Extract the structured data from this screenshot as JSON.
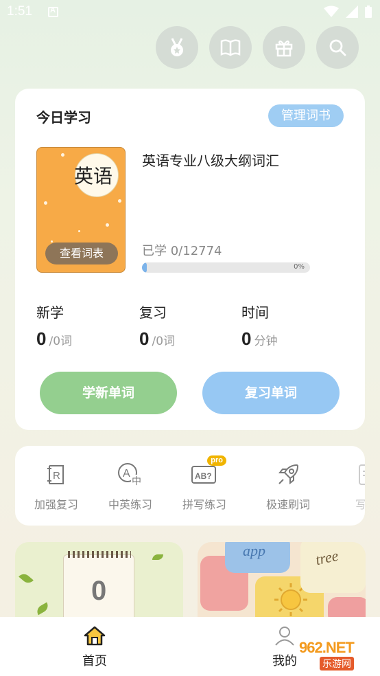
{
  "status": {
    "time": "1:51"
  },
  "top_icons": [
    "medal-icon",
    "book-icon",
    "gift-icon",
    "search-icon"
  ],
  "today": {
    "title": "今日学习",
    "manage_label": "管理词书",
    "book": {
      "cover_word": "英语",
      "view_list_label": "查看词表",
      "name": "英语专业八级大纲词汇",
      "learned_text": "已学 0/12774",
      "progress_percent": 0,
      "progress_label": "0%"
    },
    "stats": [
      {
        "label": "新学",
        "value": "0",
        "unit": "/0词"
      },
      {
        "label": "复习",
        "value": "0",
        "unit": "/0词"
      },
      {
        "label": "时间",
        "value": "0",
        "unit": "分钟"
      }
    ],
    "learn_new_label": "学新单词",
    "review_label": "复习单词"
  },
  "tools": [
    {
      "label": "加强复习",
      "icon": "review-card-icon"
    },
    {
      "label": "中英练习",
      "icon": "translate-icon"
    },
    {
      "label": "拼写练习",
      "icon": "spelling-icon",
      "badge": "pro"
    },
    {
      "label": "极速刷词",
      "icon": "rocket-icon"
    },
    {
      "label": "写作",
      "icon": "writing-icon"
    }
  ],
  "banners": {
    "calendar_number": "0",
    "tile_words": [
      "app",
      "tree"
    ]
  },
  "tabs": [
    {
      "label": "首页",
      "icon": "home-icon"
    },
    {
      "label": "我的",
      "icon": "profile-icon"
    }
  ],
  "watermark": {
    "top": "962.NET",
    "bottom": "乐游网"
  },
  "colors": {
    "accent_blue": "#97c8f3",
    "accent_green": "#94cf8f",
    "book_orange": "#f7aa47",
    "pro_badge": "#f0b400"
  }
}
